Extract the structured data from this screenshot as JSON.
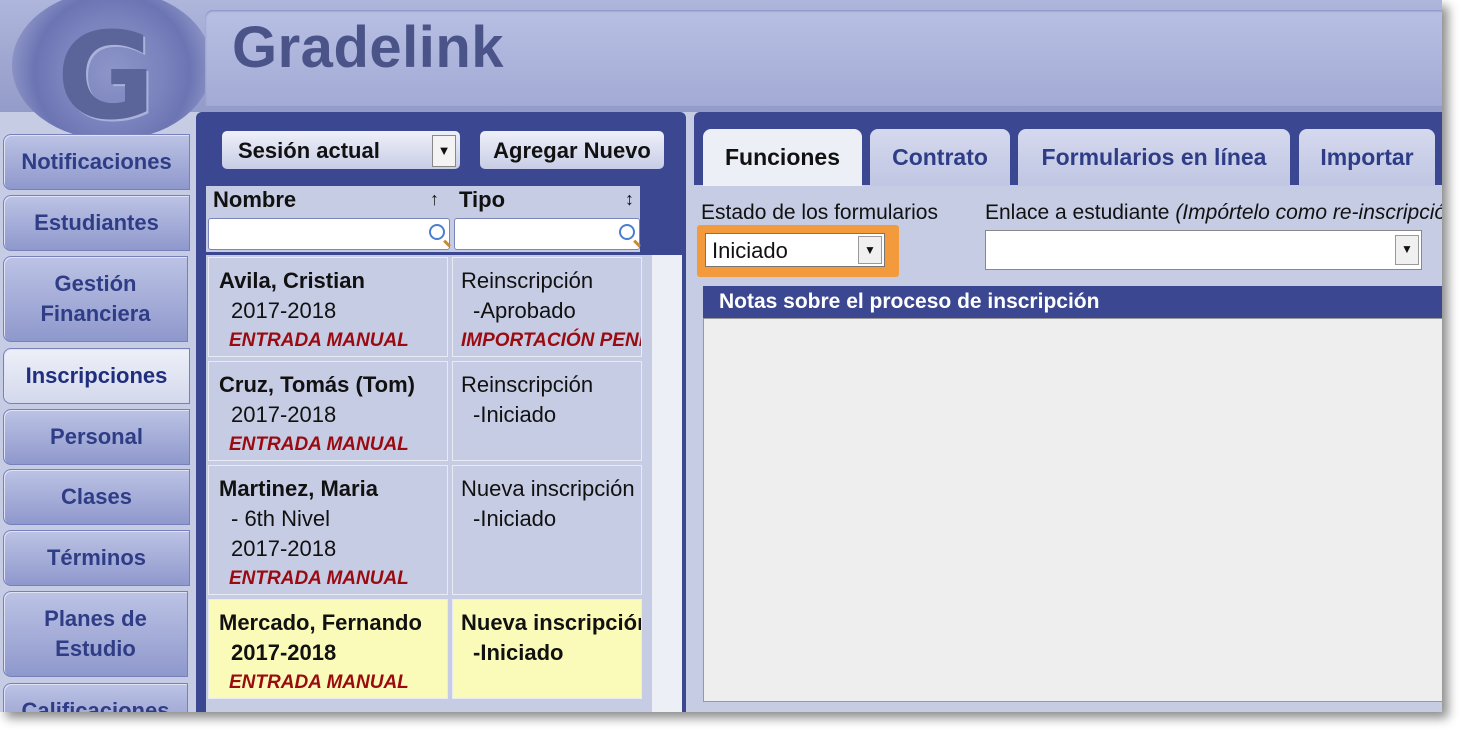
{
  "app": {
    "brand": "Gradelink"
  },
  "sidebar": {
    "items": [
      {
        "label": "Notificaciones"
      },
      {
        "label": "Estudiantes"
      },
      {
        "label": "Gestión Financiera"
      },
      {
        "label": "Inscripciones"
      },
      {
        "label": "Personal"
      },
      {
        "label": "Clases"
      },
      {
        "label": "Términos"
      },
      {
        "label": "Planes de Estudio"
      },
      {
        "label": "Calificaciones"
      }
    ],
    "active": "Inscripciones"
  },
  "list": {
    "session_select": "Sesión actual",
    "add_new": "Agregar Nuevo",
    "columns": {
      "name": "Nombre",
      "type": "Tipo"
    },
    "rows": [
      {
        "name": "Avila, Cristian",
        "grade": "",
        "year": "2017-2018",
        "source": "ENTRADA MANUAL",
        "type": "Reinscripción",
        "status": "-Aprobado",
        "type_source": "IMPORTACIÓN PENDIENTE"
      },
      {
        "name": "Cruz, Tomás (Tom)",
        "grade": "",
        "year": "2017-2018",
        "source": "ENTRADA MANUAL",
        "type": "Reinscripción",
        "status": "-Iniciado",
        "type_source": ""
      },
      {
        "name": "Martinez, Maria",
        "grade": "- 6th Nivel",
        "year": "2017-2018",
        "source": "ENTRADA MANUAL",
        "type": "Nueva inscripción",
        "status": "-Iniciado",
        "type_source": ""
      },
      {
        "name": "Mercado, Fernando",
        "grade": "",
        "year": "2017-2018",
        "source": "ENTRADA MANUAL",
        "type": "Nueva inscripción",
        "status": "-Iniciado",
        "type_source": "",
        "selected": true
      }
    ]
  },
  "detail": {
    "tabs": [
      "Funciones",
      "Contrato",
      "Formularios en línea",
      "Importar"
    ],
    "active_tab": "Funciones",
    "form_status_label": "Estado de los formularios",
    "form_status_value": "Iniciado",
    "student_link_label": "Enlace a estudiante",
    "student_link_hint": "(Impórtelo como re-inscripción)",
    "student_link_value": "",
    "notes_header": "Notas sobre el proceso de inscripción",
    "notes_value": ""
  },
  "colors": {
    "nav_text": "#2f3d87",
    "panel_dark": "#3b4891",
    "panel_light": "#c6cce4",
    "selected_row": "#fbfbb9",
    "source_text": "#9a0b11",
    "highlight_outline": "#f39a3c"
  },
  "icons": {
    "sort_asc": "arrow-up-icon",
    "sort_both": "sort-icon",
    "search": "magnifier-icon",
    "dropdown": "chevron-down-icon"
  }
}
